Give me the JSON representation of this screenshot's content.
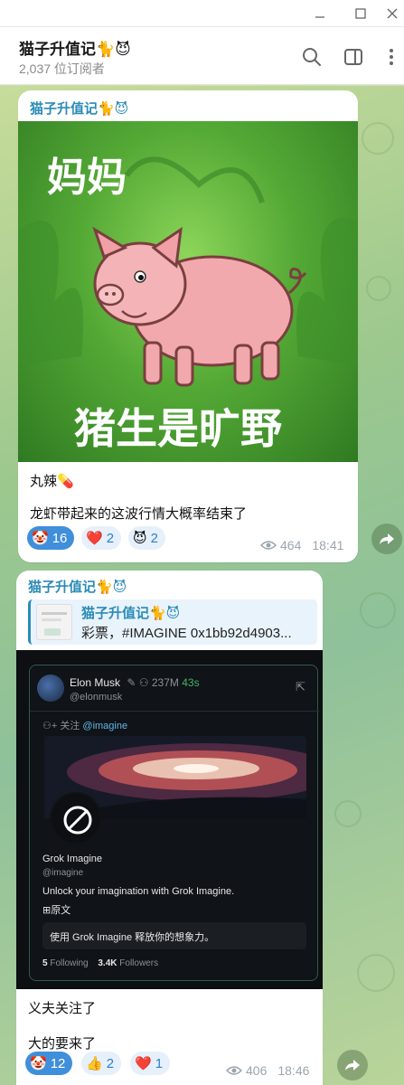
{
  "window": {
    "minimize_icon": "minimize-icon",
    "maximize_icon": "maximize-icon",
    "close_icon": "close-icon"
  },
  "header": {
    "title": "猫子升值记🐈😈",
    "subscribers": "2,037 位订阅者"
  },
  "colors": {
    "accent": "#2a8bb7",
    "reaction_mine": "#3f8fdb",
    "reaction_bg": "#e6f0fb"
  },
  "messages": [
    {
      "author": "猫子升值记🐈😈",
      "image": {
        "top_caption": "妈妈",
        "bottom_caption": "猪生是旷野"
      },
      "lines": [
        "丸辣💊",
        "龙虾带起来的这波行情大概率结束了"
      ],
      "reactions": [
        {
          "emoji": "🤡",
          "count": "16",
          "mine": true
        },
        {
          "emoji": "❤️",
          "count": "2",
          "mine": false
        },
        {
          "emoji": "😈",
          "count": "2",
          "mine": false
        }
      ],
      "views": "464",
      "time": "18:41"
    },
    {
      "author": "猫子升值记🐈😈",
      "reply": {
        "author": "猫子升值记🐈😈",
        "text": "彩票，#IMAGINE  0x1bb92d4903..."
      },
      "tweet": {
        "user_name": "Elon Musk",
        "followers_inline": "237M",
        "age": "43s",
        "handle": "@elonmusk",
        "follow_line_prefix": "关注",
        "follow_target": "@imagine",
        "profile_name": "Grok Imagine",
        "profile_handle": "@imagine",
        "bio": "Unlock your imagination with Grok Imagine.",
        "original_label": "原文",
        "translation": "使用 Grok Imagine 释放你的想象力。",
        "following_count": "5",
        "following_label": "Following",
        "followers_count": "3.4K",
        "followers_label": "Followers"
      },
      "lines": [
        "义夫关注了",
        "大的要来了"
      ],
      "reactions": [
        {
          "emoji": "🤡",
          "count": "12",
          "mine": true
        },
        {
          "emoji": "👍",
          "count": "2",
          "mine": false
        },
        {
          "emoji": "❤️",
          "count": "1",
          "mine": false
        }
      ],
      "views": "406",
      "time": "18:46"
    }
  ]
}
